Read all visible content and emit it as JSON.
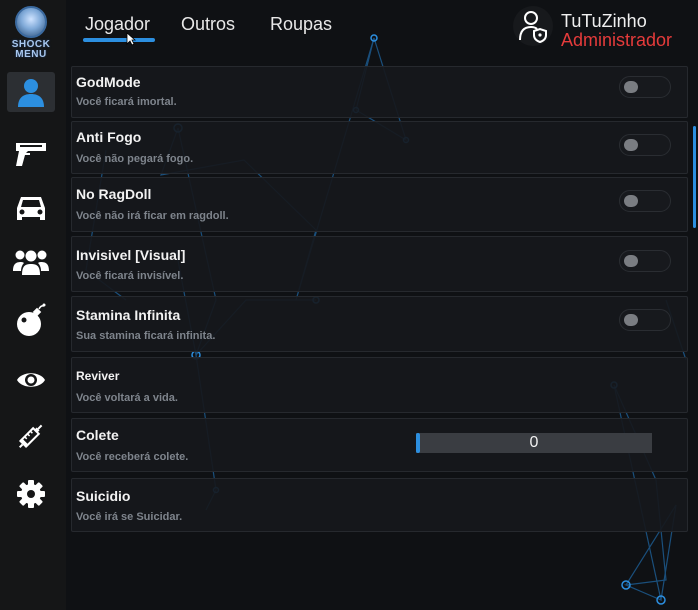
{
  "logo": {
    "text": "SHOCK\nMENU"
  },
  "sidebar": {
    "items": [
      {
        "name": "player",
        "icon": "user-icon",
        "active": true
      },
      {
        "name": "weapons",
        "icon": "pistol-icon",
        "active": false
      },
      {
        "name": "vehicles",
        "icon": "car-icon",
        "active": false
      },
      {
        "name": "players",
        "icon": "group-icon",
        "active": false
      },
      {
        "name": "explosives",
        "icon": "bomb-icon",
        "active": false
      },
      {
        "name": "vision",
        "icon": "eye-icon",
        "active": false
      },
      {
        "name": "injection",
        "icon": "syringe-icon",
        "active": false
      },
      {
        "name": "settings",
        "icon": "gear-icon",
        "active": false
      }
    ]
  },
  "tabs": [
    {
      "label": "Jogador",
      "active": true
    },
    {
      "label": "Outros",
      "active": false
    },
    {
      "label": "Roupas",
      "active": false
    }
  ],
  "user": {
    "name": "TuTuZinho",
    "role": "Administrador"
  },
  "options": [
    {
      "title": "GodMode",
      "description": "Você ficará imortal.",
      "control": "toggle",
      "enabled": false
    },
    {
      "title": "Anti Fogo",
      "description": "Você não pegará fogo.",
      "control": "toggle",
      "enabled": false
    },
    {
      "title": "No RagDoll",
      "description": "Você não irá ficar em ragdoll.",
      "control": "toggle",
      "enabled": false
    },
    {
      "title": "Invisivel [Visual]",
      "description": "Você ficará invisível.",
      "control": "toggle",
      "enabled": false
    },
    {
      "title": "Stamina Infinita",
      "description": "Sua stamina ficará infinita.",
      "control": "toggle",
      "enabled": false
    },
    {
      "title": "Reviver",
      "description": "Você voltará a vida.",
      "control": "button"
    },
    {
      "title": "Colete",
      "description": "Você receberá colete.",
      "control": "slider",
      "value": "0"
    },
    {
      "title": "Suicidio",
      "description": "Você irá se Suicidar.",
      "control": "button"
    }
  ],
  "colors": {
    "accent": "#2c8fe0",
    "role": "#e53b3b",
    "panel": "#0f1114",
    "sidebar": "#151617"
  }
}
